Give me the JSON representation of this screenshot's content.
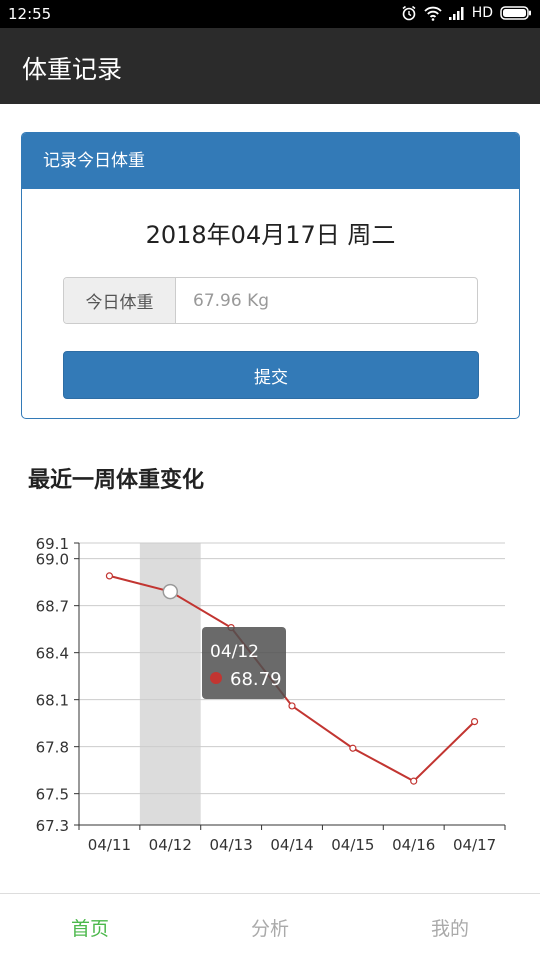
{
  "status_bar": {
    "time": "12:55",
    "network": "HD"
  },
  "app_bar": {
    "title": "体重记录"
  },
  "record_panel": {
    "header": "记录今日体重",
    "date": "2018年04月17日 周二",
    "weight_label": "今日体重",
    "weight_placeholder": "67.96 Kg",
    "submit_label": "提交"
  },
  "chart_section": {
    "title": "最近一周体重变化"
  },
  "chart_data": {
    "type": "line",
    "categories": [
      "04/11",
      "04/12",
      "04/13",
      "04/14",
      "04/15",
      "04/16",
      "04/17"
    ],
    "series": [
      {
        "values": [
          68.89,
          68.79,
          68.56,
          68.06,
          67.79,
          67.58,
          67.96
        ],
        "color": "#c23531"
      }
    ],
    "y_ticks": [
      "69.1",
      "69.0",
      "68.7",
      "68.4",
      "68.1",
      "67.8",
      "67.5",
      "67.3"
    ],
    "ylim": [
      67.3,
      69.1
    ],
    "grid": true,
    "highlight_index": 1,
    "tooltip": {
      "label": "04/12",
      "value": "68.79"
    }
  },
  "bottom_nav": {
    "items": [
      {
        "label": "首页",
        "active": true
      },
      {
        "label": "分析",
        "active": false
      },
      {
        "label": "我的",
        "active": false
      }
    ]
  }
}
